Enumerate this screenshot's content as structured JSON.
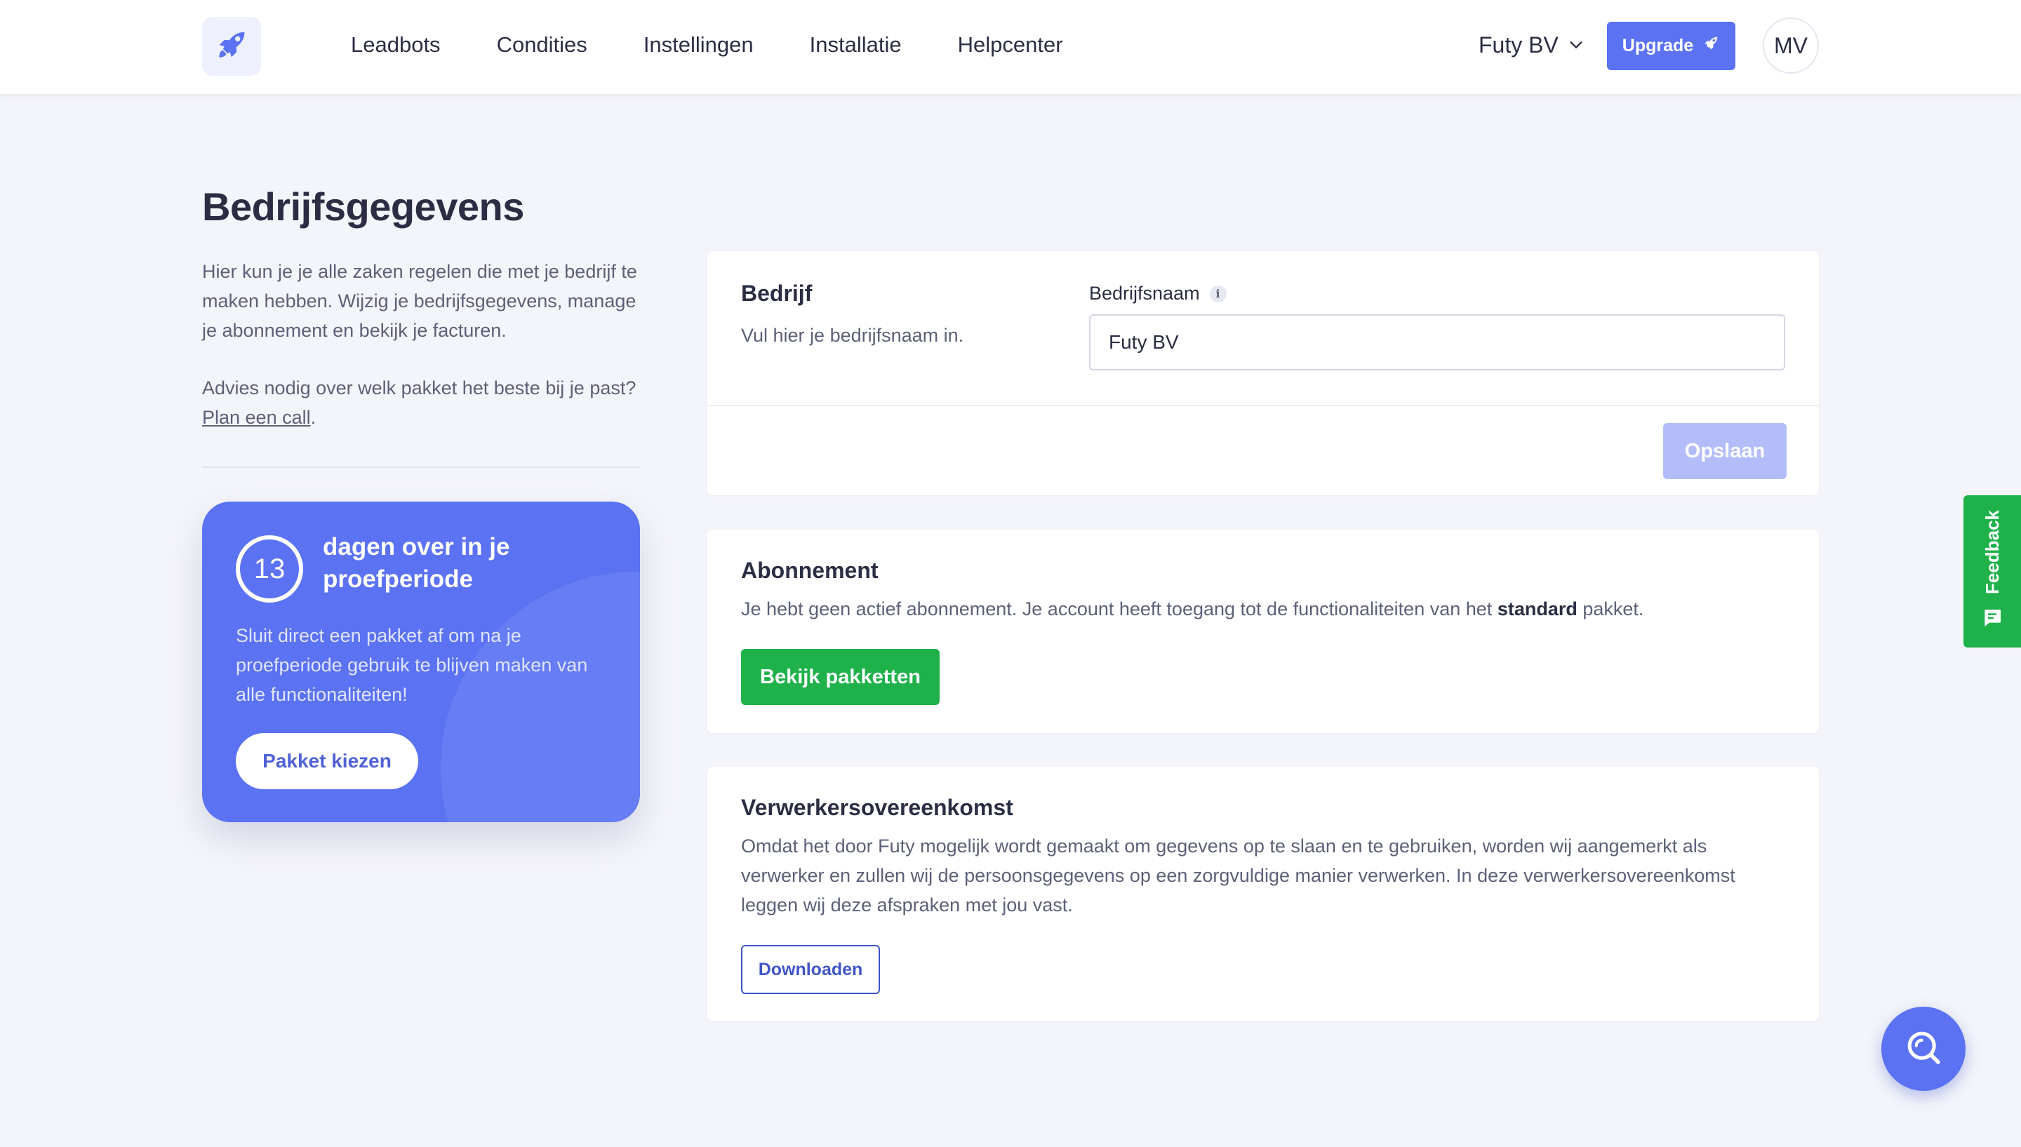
{
  "nav": {
    "logo_icon": "rocket-icon",
    "items": [
      "Leadbots",
      "Condities",
      "Instellingen",
      "Installatie",
      "Helpcenter"
    ],
    "company": "Futy BV",
    "upgrade_label": "Upgrade",
    "avatar_initials": "MV"
  },
  "page": {
    "title": "Bedrijfsgegevens",
    "intro": "Hier kun je je alle zaken regelen die met je bedrijf te maken hebben. Wijzig je bedrijfsgegevens, manage je abonnement en bekijk je facturen.",
    "advice_prefix": "Advies nodig over welk pakket het beste bij je past?",
    "advice_link": "Plan een call",
    "advice_suffix": "."
  },
  "trial": {
    "days": "13",
    "title": "dagen over in je proefperiode",
    "body": "Sluit direct een pakket af om na je proefperiode gebruik te blijven maken van alle functionaliteiten!",
    "button": "Pakket kiezen"
  },
  "company_card": {
    "title": "Bedrijf",
    "description": "Vul hier je bedrijfsnaam in.",
    "field_label": "Bedrijfsnaam",
    "info_icon": "i",
    "field_value": "Futy BV",
    "save_label": "Opslaan"
  },
  "subscription_card": {
    "title": "Abonnement",
    "text_prefix": "Je hebt geen actief abonnement. Je account heeft toegang tot de functionaliteiten van het",
    "plan": "standard",
    "text_suffix": "pakket.",
    "button": "Bekijk pakketten"
  },
  "dpa_card": {
    "title": "Verwerkersovereenkomst",
    "text": "Omdat het door Futy mogelijk wordt gemaakt om gegevens op te slaan en te gebruiken, worden wij aangemerkt als verwerker en zullen wij de persoonsgegevens op een zorgvuldige manier verwerken. In deze verwerkersovereenkomst leggen wij deze afspraken met jou vast.",
    "button": "Downloaden"
  },
  "feedback": {
    "label": "Feedback"
  },
  "colors": {
    "primary": "#5b72f2",
    "green": "#1fb24a",
    "text": "#2b2e43",
    "muted": "#5c6178",
    "background": "#f4f5fa"
  }
}
